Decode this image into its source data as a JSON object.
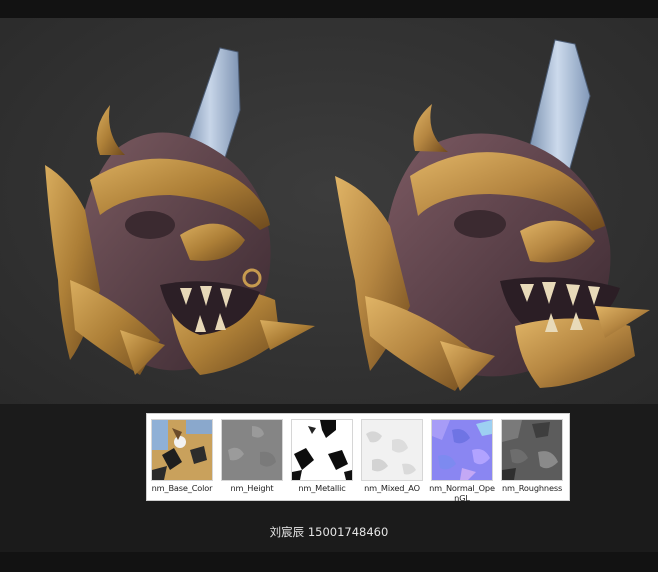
{
  "colors": {
    "background": "#1b1b1b",
    "viewport": "#343434",
    "gold": "#b8893f",
    "purple_metal": "#5a4048",
    "silver": "#9fb3cc"
  },
  "renders": [
    {
      "icon": "demon-helmet-render"
    },
    {
      "icon": "demon-helmet-render"
    }
  ],
  "textures": [
    {
      "label": "nm_Base_Color"
    },
    {
      "label": "nm_Height"
    },
    {
      "label": "nm_Metallic"
    },
    {
      "label": "nm_Mixed_AO"
    },
    {
      "label": "nm_Normal_OpenGL"
    },
    {
      "label": "nm_Roughness"
    }
  ],
  "credit": "刘宸辰 15001748460"
}
